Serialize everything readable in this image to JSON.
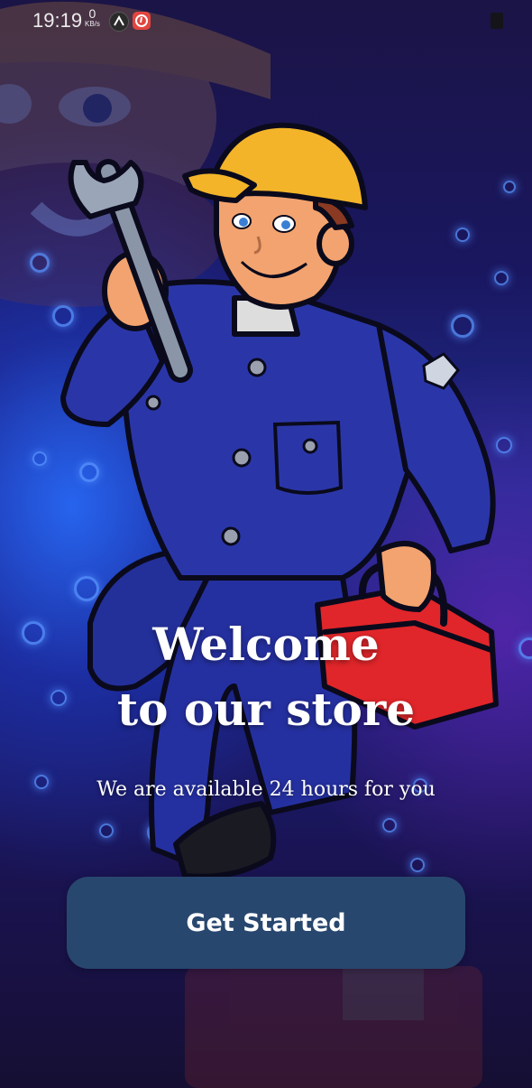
{
  "status_bar": {
    "time": "19:19",
    "speed_value": "0",
    "speed_unit": "KB/s",
    "icons": [
      "vpn-app-icon",
      "red-app-icon",
      "battery-icon"
    ]
  },
  "hero": {
    "illustration": "mechanic-with-wrench-and-toolbox",
    "background_accent": "#2f6bff"
  },
  "welcome": {
    "title_line1": "Welcome",
    "title_line2": "to our store",
    "subtitle": "We are available 24 hours for you"
  },
  "cta": {
    "label": "Get Started",
    "color": "#28476f"
  }
}
